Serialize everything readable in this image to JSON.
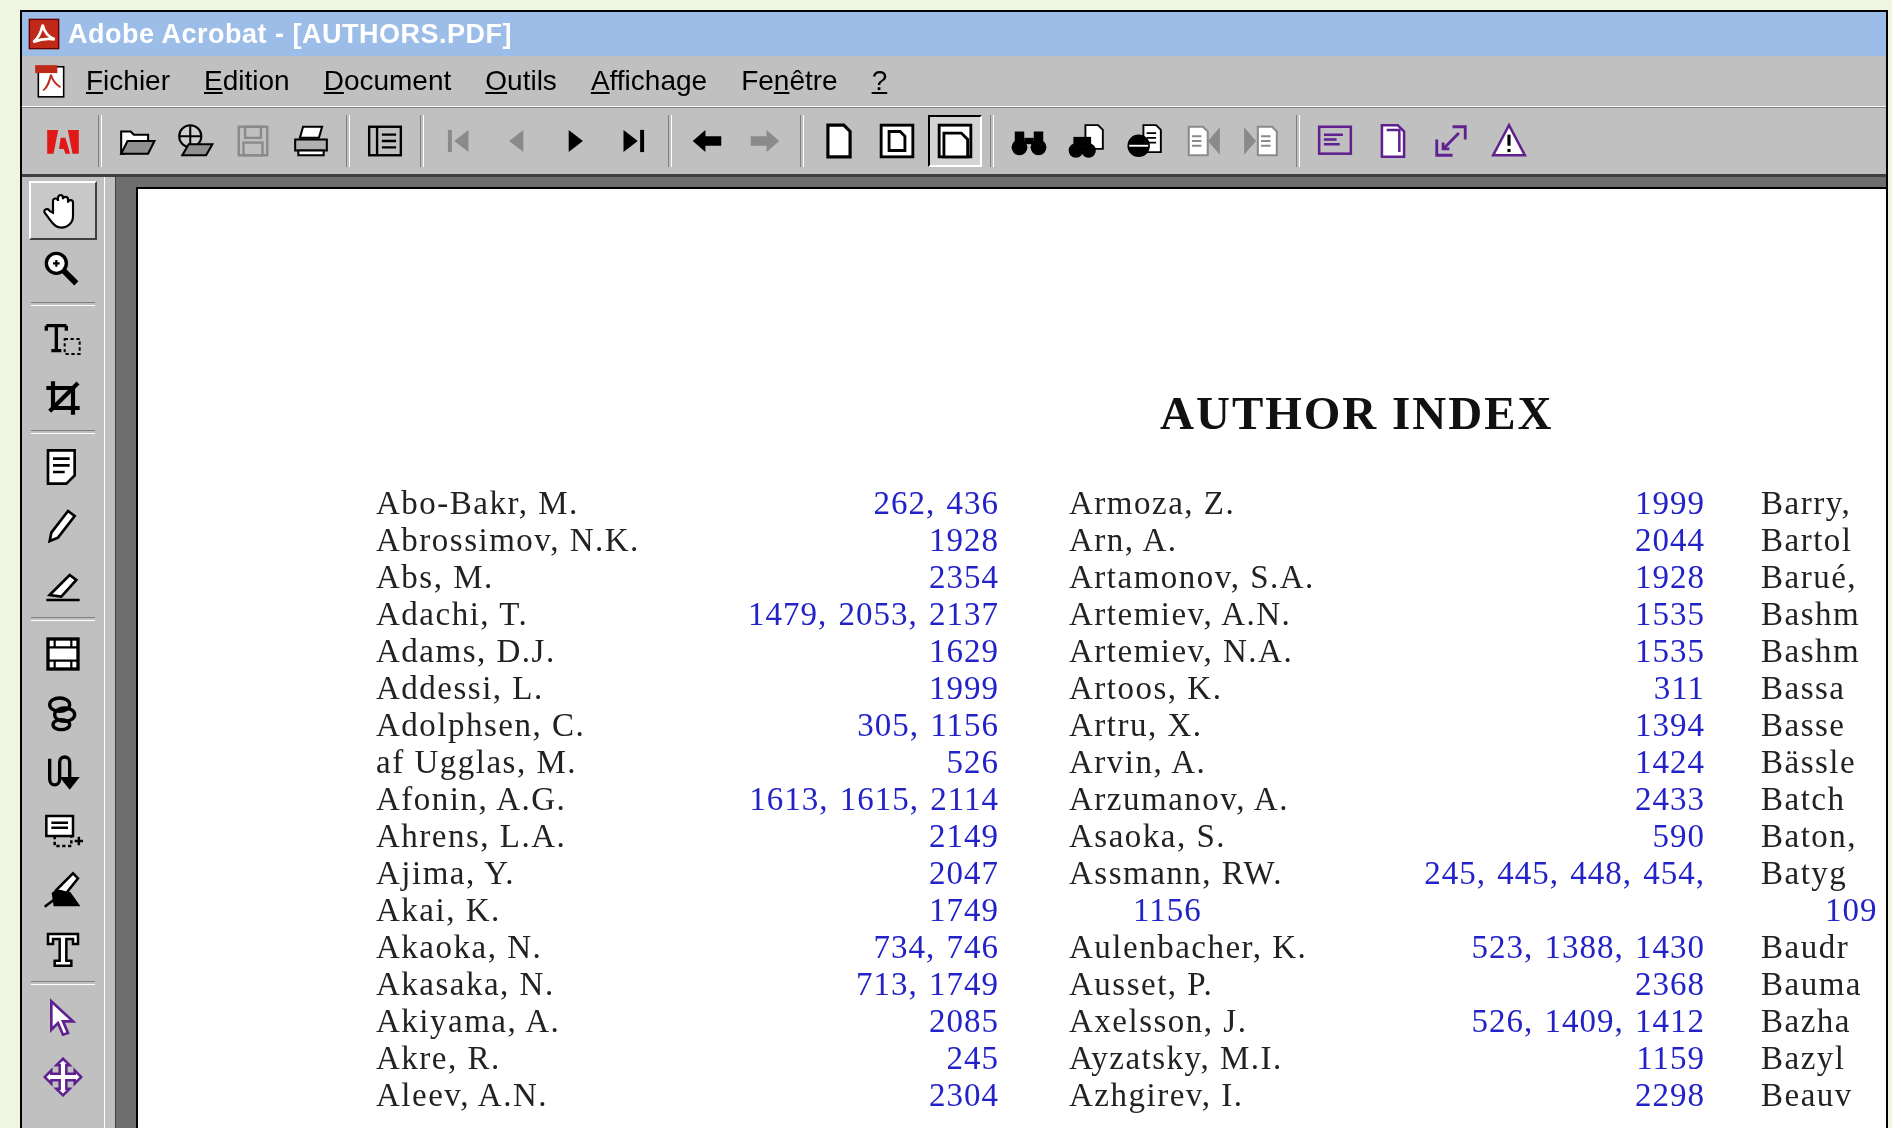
{
  "window": {
    "title": "Adobe Acrobat - [AUTHORS.PDF]"
  },
  "menu": [
    {
      "key": "F",
      "rest": "ichier"
    },
    {
      "key": "E",
      "rest": "dition"
    },
    {
      "key": "D",
      "rest": "ocument"
    },
    {
      "key": "O",
      "rest": "utils"
    },
    {
      "key": "A",
      "rest": "ffichage"
    },
    {
      "lead": "Fe",
      "key": "n",
      "rest": "être"
    },
    {
      "key": "?"
    }
  ],
  "toolbar": [
    [
      {
        "kind": "logo",
        "disabled": false
      }
    ],
    [
      {
        "kind": "open",
        "disabled": false
      },
      {
        "kind": "open-web",
        "disabled": false
      },
      {
        "kind": "save",
        "disabled": true
      },
      {
        "kind": "print",
        "disabled": false
      }
    ],
    [
      {
        "kind": "nav-pane",
        "disabled": false
      }
    ],
    [
      {
        "kind": "first",
        "disabled": true
      },
      {
        "kind": "prev",
        "disabled": true
      },
      {
        "kind": "next",
        "disabled": false
      },
      {
        "kind": "last",
        "disabled": false
      }
    ],
    [
      {
        "kind": "back",
        "disabled": false
      },
      {
        "kind": "forward",
        "disabled": true
      }
    ],
    [
      {
        "kind": "page-actual",
        "disabled": false,
        "selected": false
      },
      {
        "kind": "page-fit",
        "disabled": false,
        "selected": false
      },
      {
        "kind": "page-width",
        "disabled": false,
        "selected": true
      }
    ],
    [
      {
        "kind": "find",
        "disabled": false
      },
      {
        "kind": "search",
        "disabled": false
      },
      {
        "kind": "search-web",
        "disabled": false
      },
      {
        "kind": "prev-hit",
        "disabled": true
      },
      {
        "kind": "next-hit",
        "disabled": true
      }
    ],
    [
      {
        "kind": "form-window",
        "disabled": false
      },
      {
        "kind": "page",
        "disabled": false
      },
      {
        "kind": "expand",
        "disabled": false
      },
      {
        "kind": "warning",
        "disabled": false
      }
    ]
  ],
  "tools": [
    [
      {
        "kind": "hand",
        "selected": true
      },
      {
        "kind": "zoom",
        "selected": false
      }
    ],
    [
      {
        "kind": "text-select",
        "selected": false
      },
      {
        "kind": "crop",
        "selected": false
      }
    ],
    [
      {
        "kind": "note",
        "selected": false
      },
      {
        "kind": "pencil",
        "selected": false
      },
      {
        "kind": "highlight",
        "selected": false
      }
    ],
    [
      {
        "kind": "movie",
        "selected": false
      },
      {
        "kind": "link",
        "selected": false
      },
      {
        "kind": "article",
        "selected": false
      },
      {
        "kind": "form",
        "selected": false
      },
      {
        "kind": "signature",
        "selected": false
      },
      {
        "kind": "touchup-text",
        "selected": false
      }
    ],
    [
      {
        "kind": "select-object",
        "selected": false
      },
      {
        "kind": "move",
        "selected": false
      }
    ]
  ],
  "document": {
    "heading": "AUTHOR INDEX",
    "columns": [
      [
        {
          "name": "Abo-Bakr, M.",
          "pages": "262, 436"
        },
        {
          "name": "Abrossimov, N.K.",
          "pages": "1928"
        },
        {
          "name": "Abs, M.",
          "pages": "2354"
        },
        {
          "name": "Adachi, T.",
          "pages": "1479, 2053, 2137"
        },
        {
          "name": "Adams, D.J.",
          "pages": "1629"
        },
        {
          "name": "Addessi, L.",
          "pages": "1999"
        },
        {
          "name": "Adolphsen, C.",
          "pages": "305, 1156"
        },
        {
          "name": "af Ugglas, M.",
          "pages": "526"
        },
        {
          "name": "Afonin, A.G.",
          "pages": "1613, 1615, 2114"
        },
        {
          "name": "Ahrens, L.A.",
          "pages": "2149"
        },
        {
          "name": "Ajima, Y.",
          "pages": "2047"
        },
        {
          "name": "Akai, K.",
          "pages": "1749"
        },
        {
          "name": "Akaoka, N.",
          "pages": "734, 746"
        },
        {
          "name": "Akasaka, N.",
          "pages": "713, 1749"
        },
        {
          "name": "Akiyama, A.",
          "pages": "2085"
        },
        {
          "name": "Akre, R.",
          "pages": "245"
        },
        {
          "name": "Aleev, A.N.",
          "pages": "2304"
        }
      ],
      [
        {
          "name": "Armoza, Z.",
          "pages": "1999"
        },
        {
          "name": "Arn, A.",
          "pages": "2044"
        },
        {
          "name": "Artamonov, S.A.",
          "pages": "1928"
        },
        {
          "name": "Artemiev, A.N.",
          "pages": "1535"
        },
        {
          "name": "Artemiev, N.A.",
          "pages": "1535"
        },
        {
          "name": "Artoos, K.",
          "pages": "311"
        },
        {
          "name": "Artru, X.",
          "pages": "1394"
        },
        {
          "name": "Arvin, A.",
          "pages": "1424"
        },
        {
          "name": "Arzumanov, A.",
          "pages": "2433"
        },
        {
          "name": "Asaoka, S.",
          "pages": "590"
        },
        {
          "name": "Assmann, RW.",
          "pages": "245,  445,  448,  454,",
          "continuation": "1156"
        },
        {
          "name": "Aulenbacher, K.",
          "pages": "523, 1388, 1430"
        },
        {
          "name": "Ausset, P.",
          "pages": "2368"
        },
        {
          "name": "Axelsson, J.",
          "pages": "526, 1409, 1412"
        },
        {
          "name": "Ayzatsky, M.I.",
          "pages": "1159"
        },
        {
          "name": "Azhgirev, I.",
          "pages": "2298"
        }
      ],
      [
        {
          "name": "Barry,"
        },
        {
          "name": "Bartol"
        },
        {
          "name": "Barué,"
        },
        {
          "name": "Bashm"
        },
        {
          "name": "Bashm"
        },
        {
          "name": "Bassa"
        },
        {
          "name": "Basse"
        },
        {
          "name": "Bässle"
        },
        {
          "name": "Batch"
        },
        {
          "name": "Baton,"
        },
        {
          "name": "Batyg",
          "continuation": "109"
        },
        {
          "name": "Baudr"
        },
        {
          "name": "Bauma"
        },
        {
          "name": "Bazha"
        },
        {
          "name": "Bazyl"
        },
        {
          "name": "Beauv"
        }
      ]
    ]
  }
}
